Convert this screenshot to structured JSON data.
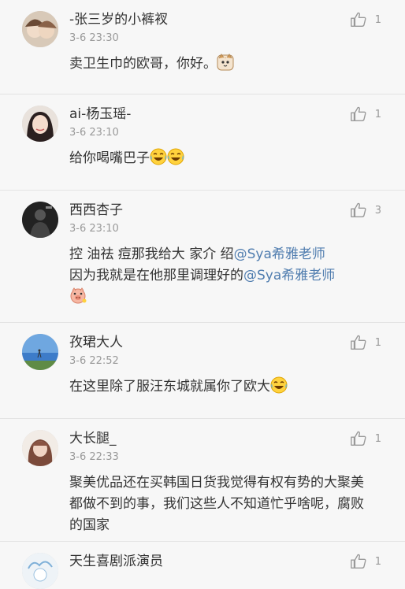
{
  "comments": [
    {
      "name": "-张三岁的小裤衩",
      "time": "3-6 23:30",
      "likes": "1",
      "text": "卖卫生巾的欧哥，你好。",
      "emoji": "cat-emoji"
    },
    {
      "name": "ai-杨玉瑶-",
      "time": "3-6 23:10",
      "likes": "1",
      "text": "给你喝嘴巴子",
      "emoji": "laugh-cry-emoji x2"
    },
    {
      "name": "西西杏子",
      "time": "3-6 23:10",
      "likes": "3",
      "text_a": "控 油祛 痘那我给大 家介 绍",
      "mention_a": "@Sya希雅老师",
      "text_b": " 因为我就是在他那里调理好的",
      "mention_b": "@Sya希雅老师",
      "emoji": "pig-emoji"
    },
    {
      "name": "孜珺大人",
      "time": "3-6 22:52",
      "likes": "1",
      "text": "在这里除了服汪东城就属你了欧大",
      "emoji": "laugh-cry-emoji"
    },
    {
      "name": "大长腿_",
      "time": "3-6 22:33",
      "likes": "1",
      "text": "聚美优品还在买韩国日货我觉得有权有势的大聚美都做不到的事，我们这些人不知道忙乎啥呢，腐败的国家"
    },
    {
      "name": "天生喜剧派演员",
      "likes": "1"
    }
  ],
  "colors": {
    "background": "#f7f7f7",
    "mention": "#507daf",
    "meta": "#999999"
  }
}
